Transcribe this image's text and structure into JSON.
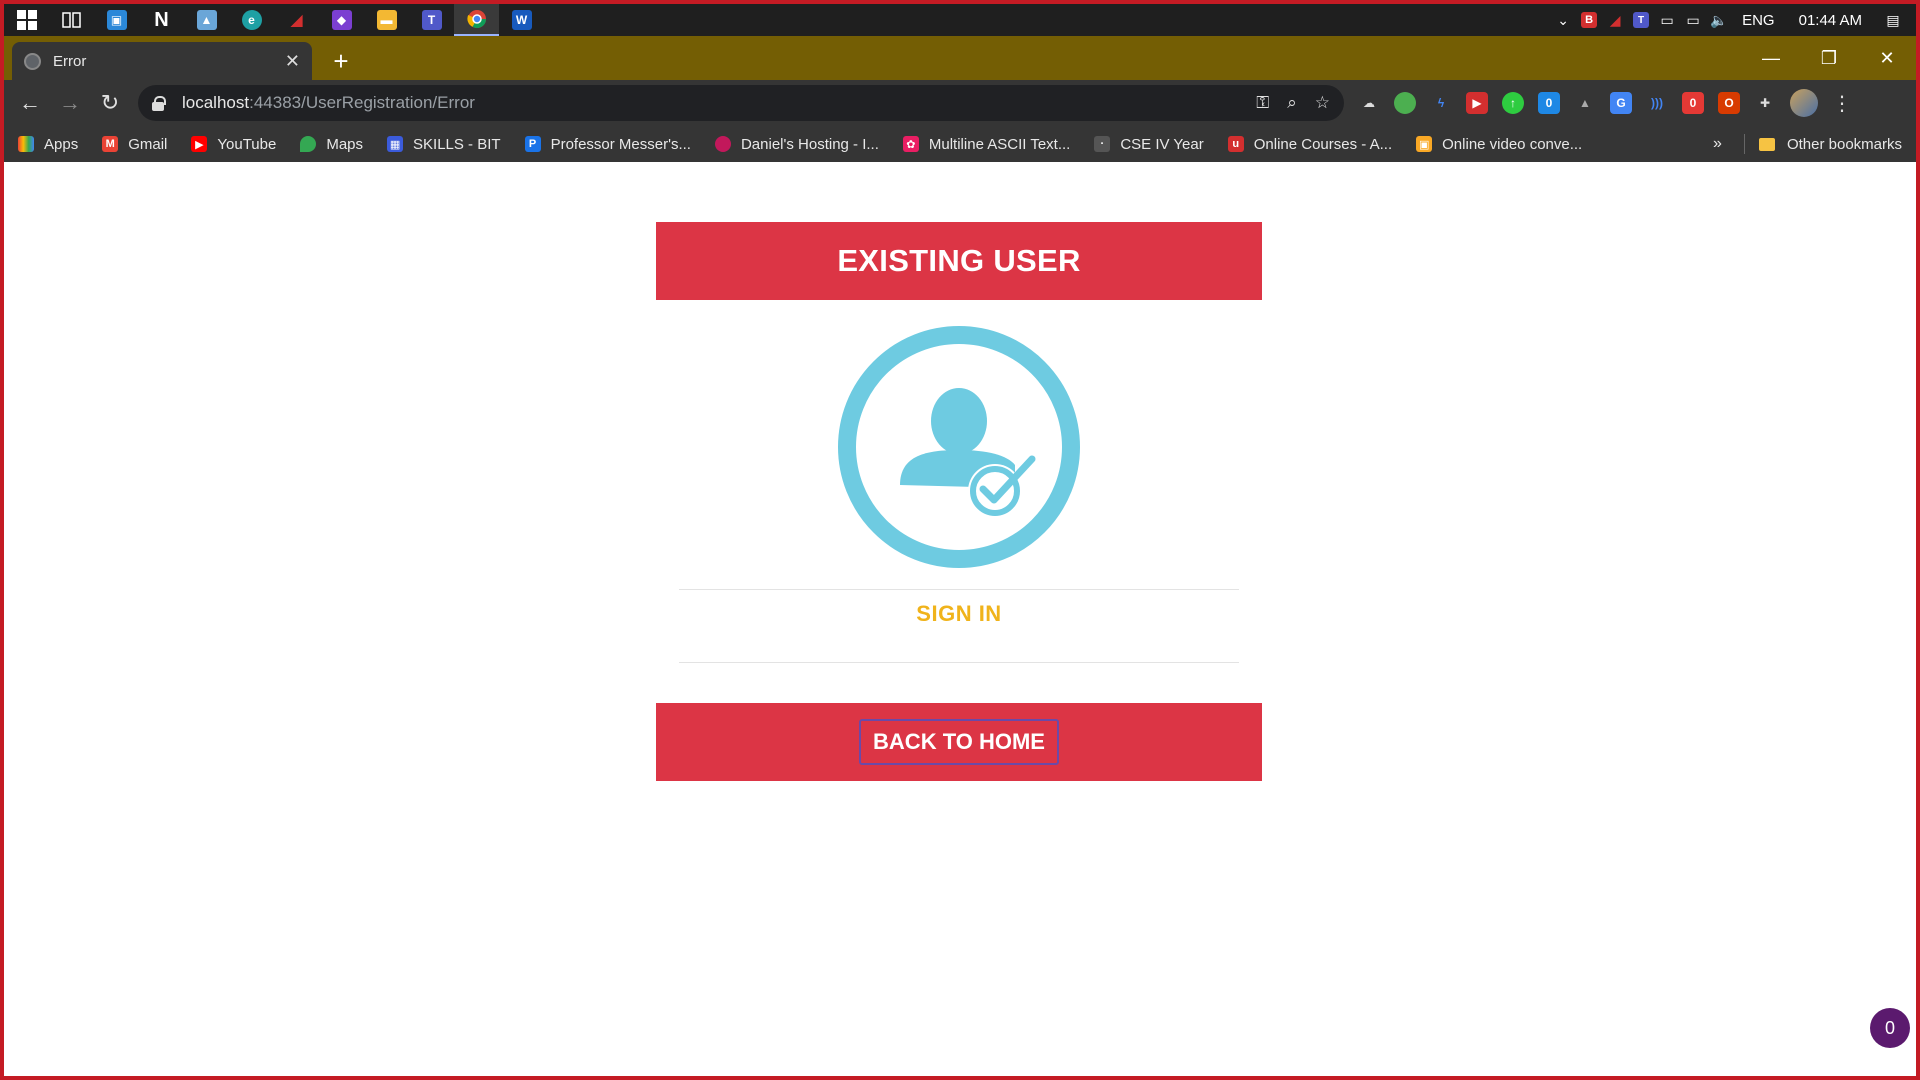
{
  "taskbar": {
    "apps": [
      {
        "icon": "windows-start-icon",
        "label": ""
      },
      {
        "icon": "task-view-icon",
        "label": ""
      },
      {
        "icon": "app-icon",
        "label": ""
      },
      {
        "icon": "notion-icon",
        "label": ""
      },
      {
        "icon": "photos-icon",
        "label": ""
      },
      {
        "icon": "edge-icon",
        "label": ""
      },
      {
        "icon": "ftp-icon",
        "label": ""
      },
      {
        "icon": "visual-studio-icon",
        "label": ""
      },
      {
        "icon": "file-explorer-icon",
        "label": ""
      },
      {
        "icon": "teams-icon",
        "label": ""
      },
      {
        "icon": "chrome-icon",
        "label": ""
      },
      {
        "icon": "word-icon",
        "label": ""
      }
    ],
    "tray": {
      "language": "ENG",
      "time": "01:44 AM"
    }
  },
  "browser": {
    "tab": {
      "title": "Error"
    },
    "url": {
      "host": "localhost",
      "rest": ":44383/UserRegistration/Error"
    },
    "bookmarks": [
      {
        "label": "Apps",
        "color": "#4285f4"
      },
      {
        "label": "Gmail",
        "color": "#ea4335"
      },
      {
        "label": "YouTube",
        "color": "#ff0000"
      },
      {
        "label": "Maps",
        "color": "#34a853"
      },
      {
        "label": "SKILLS - BIT",
        "color": "#3b5bdb"
      },
      {
        "label": "Professor Messer's...",
        "color": "#1a73e8"
      },
      {
        "label": "Daniel's Hosting - I...",
        "color": "#c2185b"
      },
      {
        "label": "Multiline ASCII Text...",
        "color": "#e91e63"
      },
      {
        "label": "CSE IV Year",
        "color": "#555555"
      },
      {
        "label": "Online Courses - A...",
        "color": "#d32f2f"
      },
      {
        "label": "Online video conve...",
        "color": "#f9a825"
      }
    ],
    "other_bookmarks": "Other bookmarks",
    "chevron": "»"
  },
  "page": {
    "banner": "EXISTING USER",
    "signin": "SIGN IN",
    "back": "BACK TO HOME",
    "badge_count": "0"
  },
  "colors": {
    "danger": "#dc3545",
    "warning": "#f0b31b",
    "icon": "#6ecbe1"
  }
}
